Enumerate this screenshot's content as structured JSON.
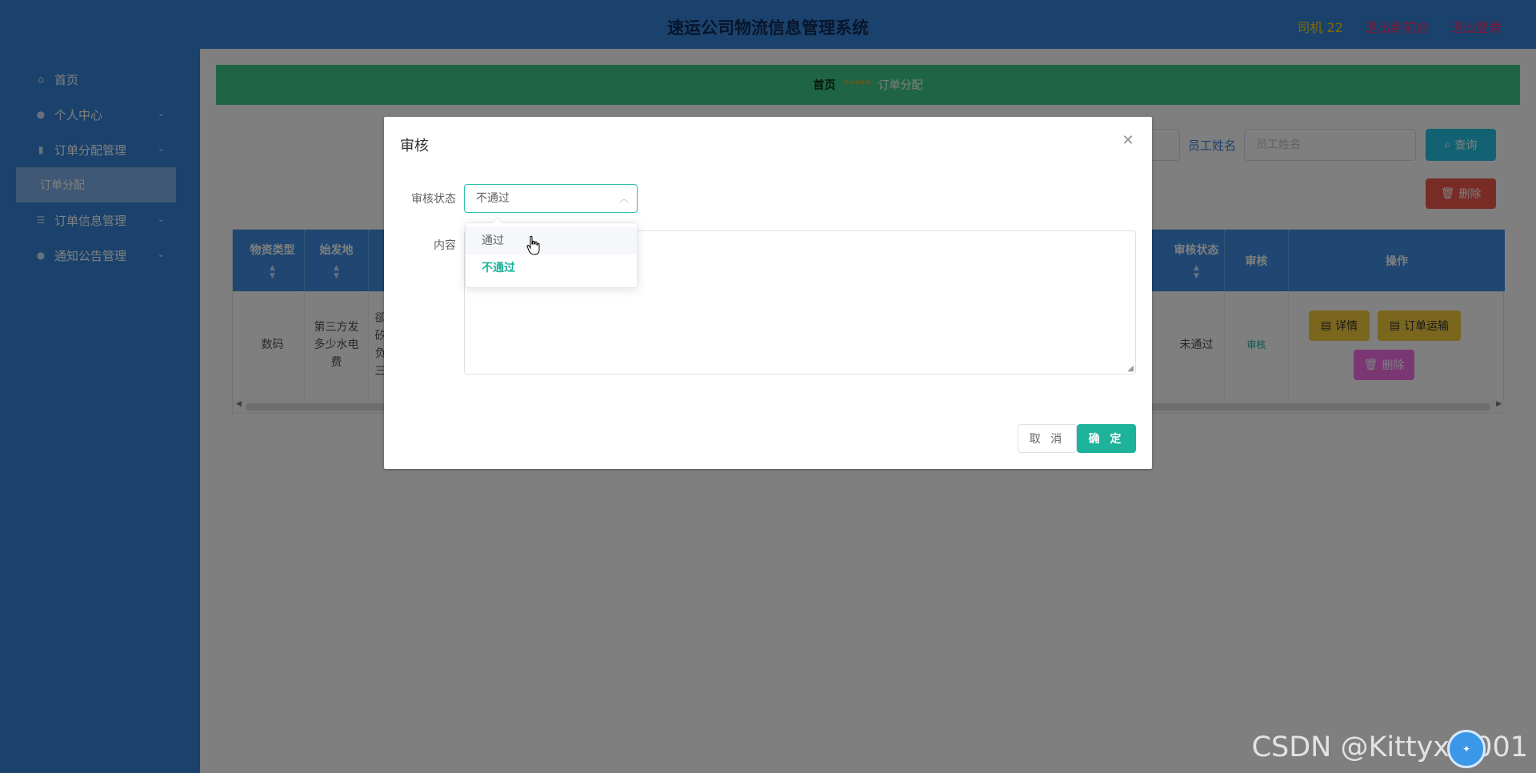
{
  "header": {
    "title": "速运公司物流信息管理系统",
    "user": "司机 22",
    "back_link": "退出到前台",
    "logout_link": "退出登录"
  },
  "sidebar": {
    "items": [
      {
        "label": "首页",
        "icon": "home-icon"
      },
      {
        "label": "个人中心",
        "icon": "user-icon"
      },
      {
        "label": "订单分配管理",
        "icon": "chart-icon"
      },
      {
        "label": "订单分配",
        "icon": ""
      },
      {
        "label": "订单信息管理",
        "icon": "list-icon"
      },
      {
        "label": "通知公告管理",
        "icon": "user-icon"
      }
    ]
  },
  "breadcrumb": {
    "home": "首页",
    "separator": "*****",
    "current": "订单分配"
  },
  "search": {
    "employee_label": "员工姓名",
    "employee_placeholder": "员工姓名",
    "query_button": "查询",
    "delete_button": "删除"
  },
  "table": {
    "headers": [
      "物资类型",
      "始发地",
      "审核状态",
      "审核",
      "操作"
    ],
    "row": {
      "type": "数码",
      "origin": "第三方发多少水电费",
      "partial_col": "卻矽负三",
      "status": "未通过",
      "review_link": "审核",
      "detail_button": "详情",
      "transport_button": "订单运输",
      "delete_button": "删除"
    }
  },
  "dialog": {
    "title": "审核",
    "status_label": "审核状态",
    "status_value": "不通过",
    "content_label": "内容",
    "cancel_button": "取 消",
    "ok_button": "确 定",
    "options": [
      "通过",
      "不通过"
    ]
  },
  "watermark": {
    "text": "CSDN @Kittyxia001"
  }
}
